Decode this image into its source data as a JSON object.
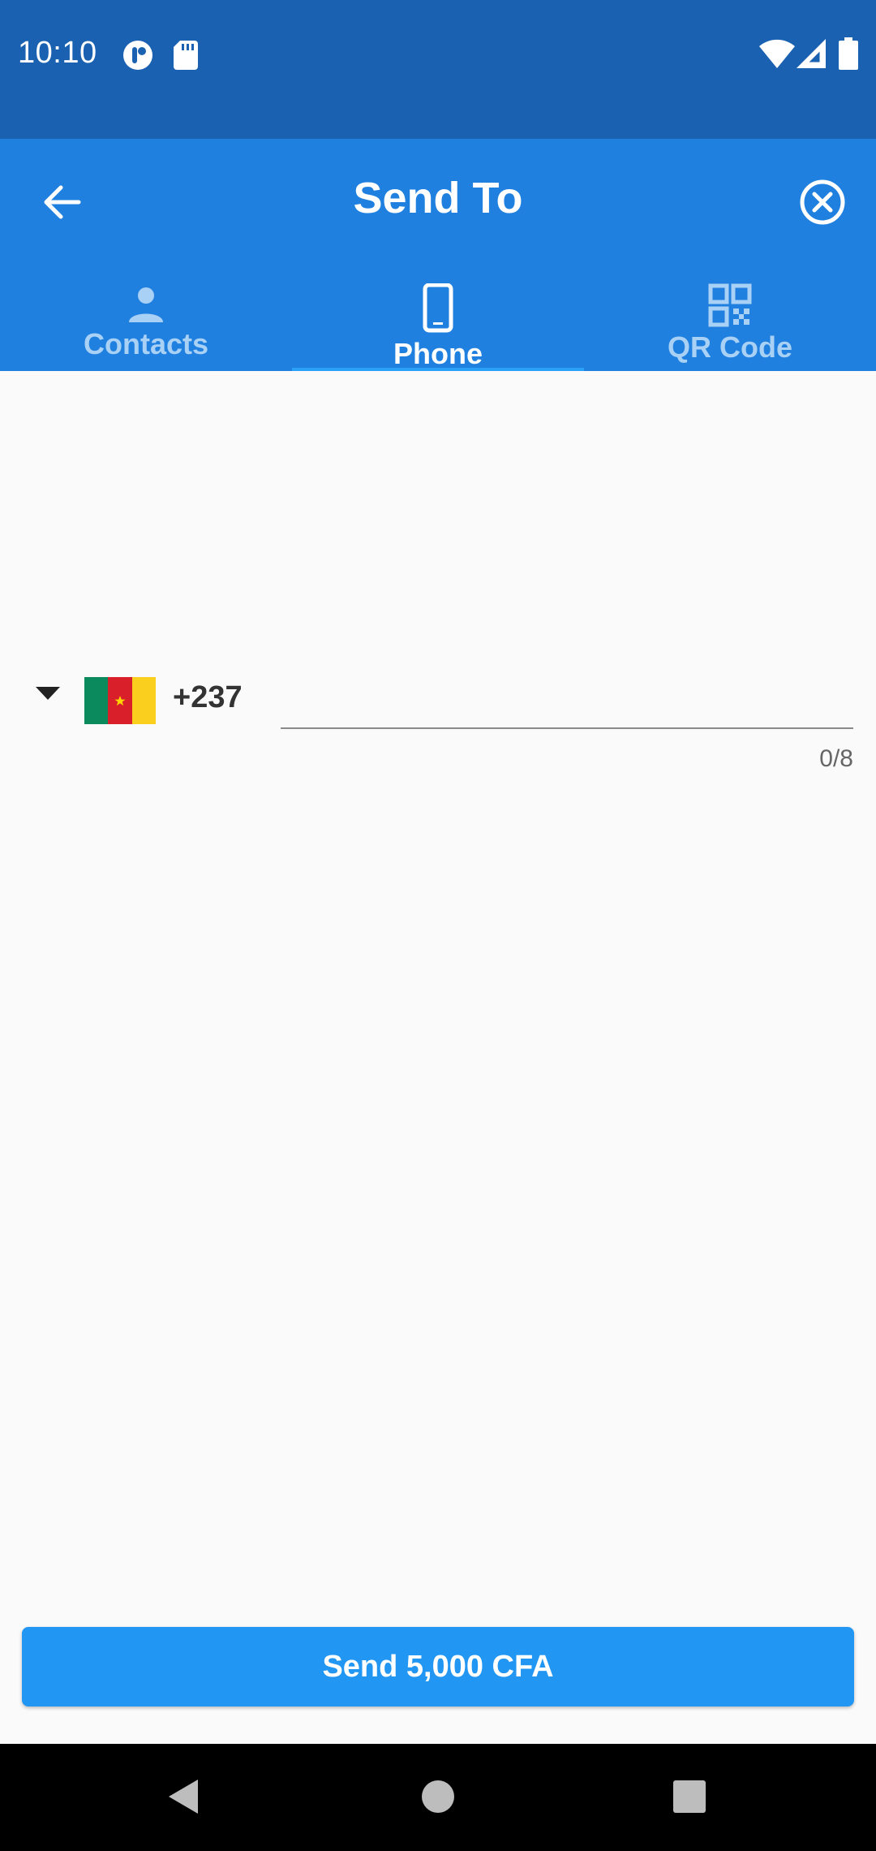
{
  "status_bar": {
    "time": "10:10",
    "icons": [
      "sync-icon",
      "sd-card-icon",
      "wifi-icon",
      "signal-icon",
      "battery-icon"
    ]
  },
  "app_bar": {
    "title": "Send To",
    "back_icon": "arrow-back-icon",
    "close_icon": "close-circle-icon"
  },
  "tabs": [
    {
      "label": "Contacts",
      "icon": "person-icon",
      "active": false
    },
    {
      "label": "Phone",
      "icon": "smartphone-icon",
      "active": true
    },
    {
      "label": "QR Code",
      "icon": "qr-code-icon",
      "active": false
    }
  ],
  "phone_entry": {
    "country": "Cameroon",
    "dial_code": "+237",
    "value": "",
    "counter": "0/8"
  },
  "send_button": {
    "label": "Send 5,000 CFA"
  },
  "colors": {
    "status_bar": "#1a62b1",
    "app_bar": "#1f80e0",
    "accent": "#2196f3",
    "tab_inactive": "#a9d0f5",
    "tab_indicator": "#2aa0f7"
  }
}
